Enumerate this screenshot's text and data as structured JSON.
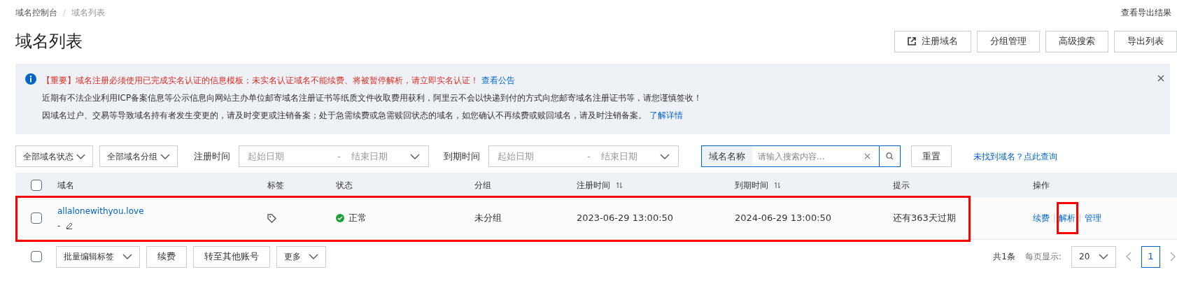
{
  "breadcrumb": [
    {
      "label": "域名控制台",
      "current": false
    },
    {
      "label": "域名列表",
      "current": true
    }
  ],
  "breadcrumb_separator": "/",
  "export_results_link": "查看导出结果",
  "title": "域名列表",
  "header_buttons": [
    {
      "label": "注册域名",
      "kind": "external"
    },
    {
      "label": "分组管理",
      "kind": "plain"
    },
    {
      "label": "高级搜索",
      "kind": "plain"
    },
    {
      "label": "导出列表",
      "kind": "plain"
    }
  ],
  "notice": {
    "lines": [
      {
        "text": "【重要】域名注册必须使用已完成实名认证的信息模板；未实名认证域名不能续费、将被暂停解析，请立即实名认证！",
        "kind": "warning",
        "link": "查看公告"
      },
      {
        "text": "近期有不法企业利用ICP备案信息等公示信息向网站主办单位邮寄域名注册证书等纸质文件收取费用获利，阿里云不会以快递到付的方式向您邮寄域名注册证书等，请您谨慎签收！",
        "kind": "normal"
      },
      {
        "text": "因域名过户、交易等导致域名持有者发生变更的，请及时变更或注销备案；处于急需续费或急需赎回状态的域名，如您确认不再续费或赎回域名，请及时注销备案。",
        "kind": "normal",
        "link": "了解详情"
      }
    ]
  },
  "filters": {
    "status_select": "全部域名状态",
    "group_select": "全部域名分组",
    "registration_time": {
      "label": "注册时间",
      "start_placeholder": "起始日期",
      "separator": "-",
      "end_placeholder": "结束日期"
    },
    "expiry_time": {
      "label": "到期时间",
      "start_placeholder": "起始日期",
      "separator": "-",
      "end_placeholder": "结束日期"
    },
    "search": {
      "field_label": "域名名称",
      "placeholder": "请输入搜索内容..."
    },
    "reset_button": "重置",
    "not_found_link": "未找到域名？点此查询"
  },
  "table": {
    "columns": [
      {
        "label": "域名"
      },
      {
        "label": "标签"
      },
      {
        "label": "状态"
      },
      {
        "label": "分组"
      },
      {
        "label": "注册时间",
        "sortable": true
      },
      {
        "label": "到期时间",
        "sortable": true
      },
      {
        "label": "提示"
      },
      {
        "label": "操作"
      }
    ],
    "select_all_checked": false,
    "rows": [
      {
        "checked": false,
        "highlighted": true,
        "domain": "allalonewithyou.love",
        "remark": "-",
        "status": "正常",
        "group": "未分组",
        "registered": "2023-06-29 13:00:50",
        "expires": "2024-06-29 13:00:50",
        "hint": "还有363天过期",
        "actions": [
          {
            "label": "续费",
            "highlighted": false
          },
          {
            "label": "解析",
            "highlighted": true
          },
          {
            "label": "管理",
            "highlighted": false
          }
        ]
      }
    ]
  },
  "footer": {
    "select_all_checked": false,
    "batch_tag_select": "批量编辑标签",
    "buttons": [
      "续费",
      "转至其他账号"
    ],
    "more_select": "更多",
    "total": "共1条",
    "page_size_label": "每页显示:",
    "page_size": "20",
    "pages": [
      {
        "label": "1",
        "selected": true
      }
    ]
  }
}
